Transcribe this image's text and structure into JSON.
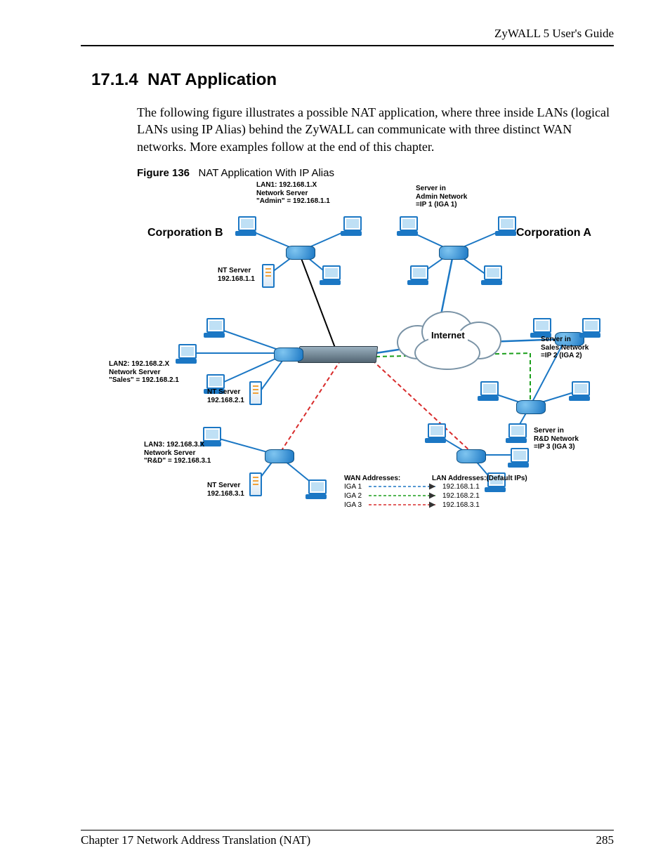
{
  "header": {
    "guide": "ZyWALL 5 User's Guide"
  },
  "section": {
    "number": "17.1.4",
    "title": "NAT Application",
    "paragraph": "The following figure illustrates a possible NAT application, where three inside LANs (logical LANs using IP Alias) behind the ZyWALL can communicate with three distinct WAN networks. More examples follow at the end of this chapter."
  },
  "figure": {
    "label": "Figure 136",
    "title": "NAT Application With IP Alias",
    "corpA": "Corporation A",
    "corpB": "Corporation B",
    "internet": "Internet",
    "lan1_a": "LAN1: 192.168.1.X",
    "lan1_b": "Network Server",
    "lan1_c": "\"Admin\" = 192.168.1.1",
    "nt1_a": "NT Server",
    "nt1_b": "192.168.1.1",
    "lan2_a": "LAN2: 192.168.2.X",
    "lan2_b": "Network Server",
    "lan2_c": "\"Sales\" = 192.168.2.1",
    "nt2_a": "NT Server",
    "nt2_b": "192.168.2.1",
    "lan3_a": "LAN3: 192.168.3.X",
    "lan3_b": "Network Server",
    "lan3_c": "\"R&D\" = 192.168.3.1",
    "nt3_a": "NT Server",
    "nt3_b": "192.168.3.1",
    "srvAdmin_a": "Server in",
    "srvAdmin_b": "Admin Network",
    "srvAdmin_c": "=IP 1 (IGA 1)",
    "srvSales_a": "Server in",
    "srvSales_b": "Sales  Network",
    "srvSales_c": "=IP 2 (IGA 2)",
    "srvRD_a": "Server in",
    "srvRD_b": "R&D Network",
    "srvRD_c": "=IP 3 (IGA 3)",
    "wanHdr": "WAN Addresses:",
    "lanHdr": "LAN Addresses:(Default IPs)",
    "iga1": "IGA 1",
    "iga2": "IGA 2",
    "iga3": "IGA 3",
    "lanip1": "192.168.1.1",
    "lanip2": "192.168.2.1",
    "lanip3": "192.168.3.1"
  },
  "footer": {
    "chapter": "Chapter 17 Network Address Translation (NAT)",
    "page": "285"
  }
}
